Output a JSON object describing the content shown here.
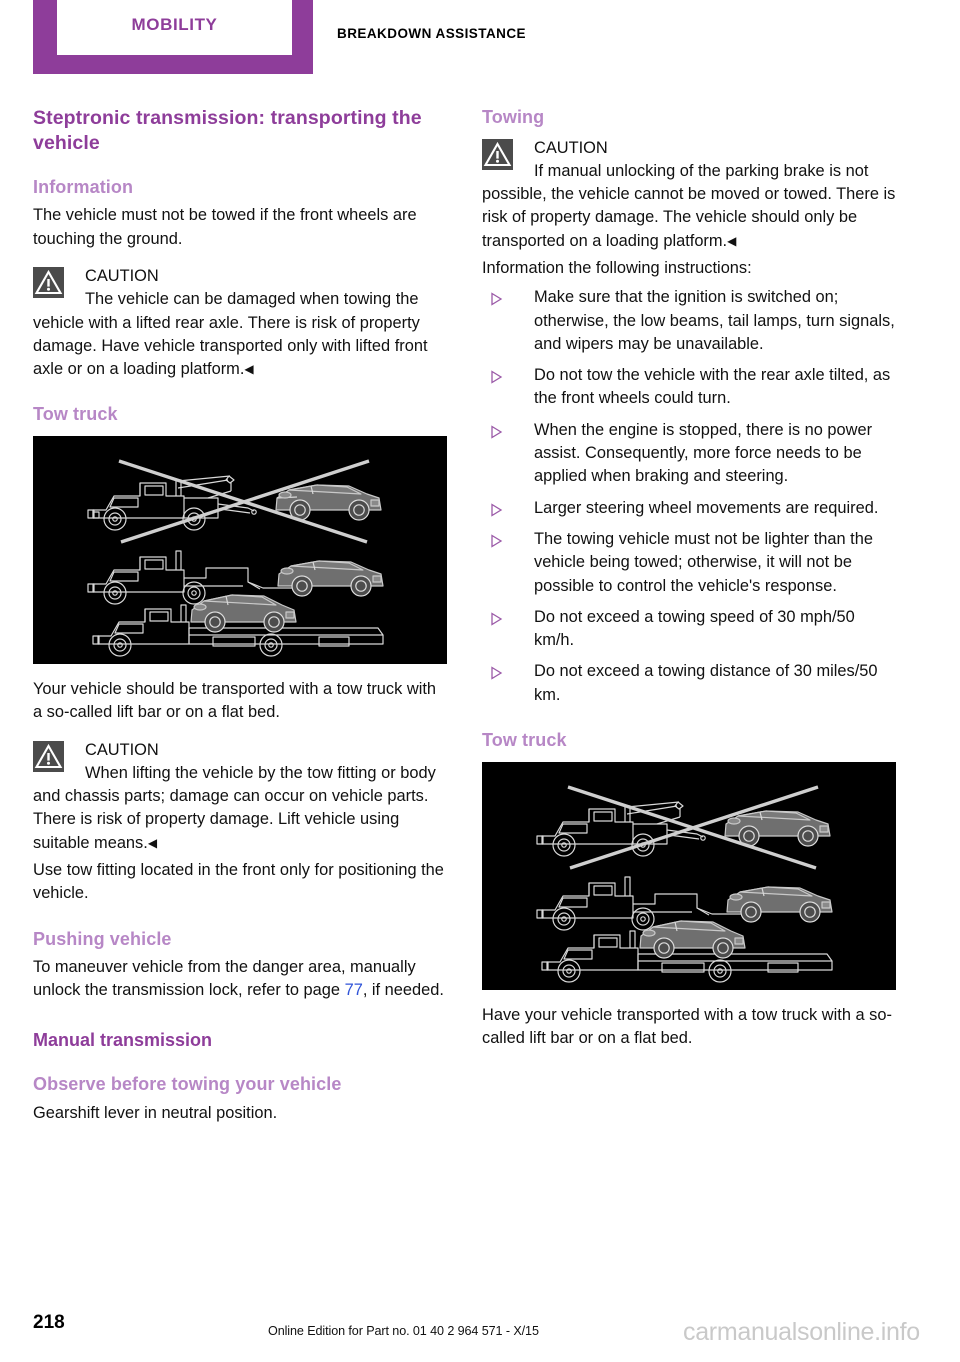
{
  "header": {
    "tab_label": "MOBILITY",
    "section_label": "BREAKDOWN ASSISTANCE",
    "tab_color": "#8e3d9a"
  },
  "colors": {
    "title_purple": "#8e3d9a",
    "subheading_purple": "#b787c6",
    "link_blue": "#2f53d8",
    "caution_icon_bg": "#4b4b4b",
    "figure_bg": "#000000"
  },
  "left_column": {
    "title": "Steptronic transmission: transporting the vehicle",
    "information_heading": "Information",
    "information_text": "The vehicle must not be towed if the front wheels are touching the ground.",
    "caution_1": {
      "label": "CAUTION",
      "text": "The vehicle can be damaged when towing the vehicle with a lifted rear axle. There is risk of property damage. Have vehicle transported only with lifted front axle or on a loading platform.",
      "endmark": "◀"
    },
    "tow_truck_heading": "Tow truck",
    "figure_caption": "Your vehicle should be transported with a tow truck with a so-called lift bar or on a flat bed.",
    "caution_2": {
      "label": "CAUTION",
      "text": "When lifting the vehicle by the tow fitting or body and chassis parts; damage can occur on vehicle parts. There is risk of property damage. Lift vehicle using suitable means.",
      "endmark": "◀"
    },
    "tow_fitting_text": "Use tow fitting located in the front only for positioning the vehicle.",
    "pushing_heading": "Pushing vehicle",
    "pushing_text_before": "To maneuver vehicle from the danger area, manually unlock the transmission lock, refer to page ",
    "pushing_page_link": "77",
    "pushing_text_after": ", if needed.",
    "manual_transmission_heading": "Manual transmission",
    "observe_heading": "Observe before towing your vehicle",
    "observe_text": "Gearshift lever in neutral position."
  },
  "right_column": {
    "towing_heading": "Towing",
    "caution_1": {
      "label": "CAUTION",
      "text": "If manual unlocking of the parking brake is not possible, the vehicle cannot be moved or towed. There is risk of property damage. The vehicle should only be transported on a loading platform.",
      "endmark": "◀"
    },
    "instructions_intro": "Information the following instructions:",
    "bullets": [
      "Make sure that the ignition is switched on; otherwise, the low beams, tail lamps, turn signals, and wipers may be unavailable.",
      "Do not tow the vehicle with the rear axle tilted, as the front wheels could turn.",
      "When the engine is stopped, there is no power assist. Consequently, more force needs to be applied when braking and steering.",
      "Larger steering wheel movements are required.",
      "The towing vehicle must not be lighter than the vehicle being towed; otherwise, it will not be possible to control the vehicle's response.",
      "Do not exceed a towing speed of 30 mph/50 km/h.",
      "Do not exceed a towing distance of 30 miles/50 km."
    ],
    "tow_truck_heading": "Tow truck",
    "figure_caption": "Have your vehicle transported with a tow truck with a so-called lift bar or on a flat bed."
  },
  "footer": {
    "page_number": "218",
    "edition": "Online Edition for Part no. 01 40 2 964 571 - X/15",
    "watermark": "carmanualsonline.info"
  }
}
